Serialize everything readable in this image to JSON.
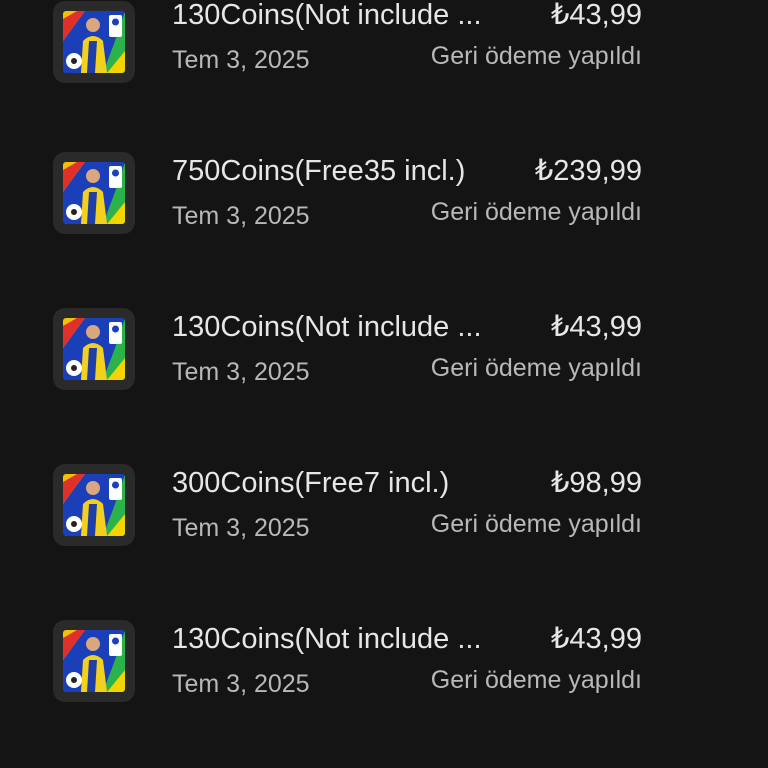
{
  "purchases": [
    {
      "title": "130Coins(Not include ...",
      "date": "Tem 3, 2025",
      "price": "₺43,99",
      "status": "Geri ödeme yapıldı",
      "icon": "efootball-app-icon"
    },
    {
      "title": "750Coins(Free35 incl.)",
      "date": "Tem 3, 2025",
      "price": "₺239,99",
      "status": "Geri ödeme yapıldı",
      "icon": "efootball-app-icon"
    },
    {
      "title": "130Coins(Not include ...",
      "date": "Tem 3, 2025",
      "price": "₺43,99",
      "status": "Geri ödeme yapıldı",
      "icon": "efootball-app-icon"
    },
    {
      "title": "300Coins(Free7 incl.)",
      "date": "Tem 3, 2025",
      "price": "₺98,99",
      "status": "Geri ödeme yapıldı",
      "icon": "efootball-app-icon"
    },
    {
      "title": "130Coins(Not include ...",
      "date": "Tem 3, 2025",
      "price": "₺43,99",
      "status": "Geri ödeme yapıldı",
      "icon": "efootball-app-icon"
    }
  ],
  "colors": {
    "background": "#141414",
    "primary_text": "#e6e6e6",
    "secondary_text": "#b8b8b8"
  }
}
